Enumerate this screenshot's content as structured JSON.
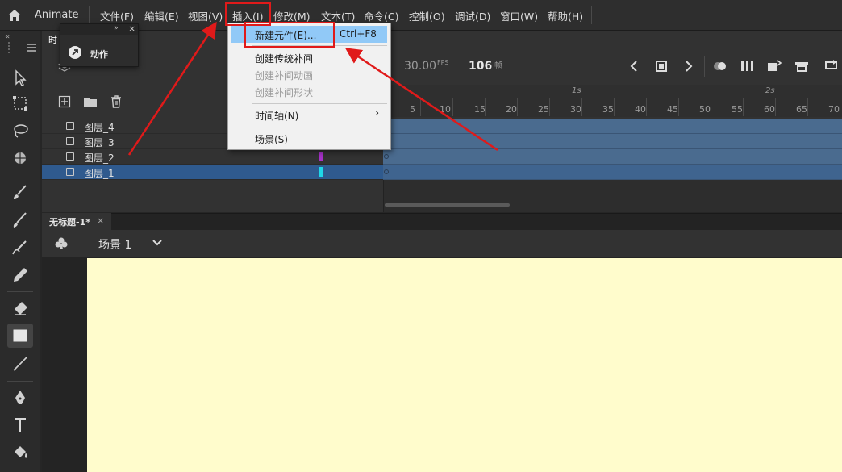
{
  "app": {
    "name": "Animate"
  },
  "menubar": {
    "items": [
      "文件(F)",
      "编辑(E)",
      "视图(V)",
      "插入(I)",
      "修改(M)",
      "文本(T)",
      "命令(C)",
      "控制(O)",
      "调试(D)",
      "窗口(W)",
      "帮助(H)"
    ]
  },
  "insert_menu": {
    "items": [
      {
        "label": "新建元件(E)...",
        "shortcut": "Ctrl+F8",
        "highlighted": true
      },
      {
        "label": "创建传统补间",
        "enabled": true
      },
      {
        "label": "创建补间动画",
        "enabled": false
      },
      {
        "label": "创建补间形状",
        "enabled": false
      },
      {
        "label": "时间轴(N)",
        "submenu": true
      },
      {
        "label": "场景(S)"
      }
    ]
  },
  "timeline": {
    "tab_label": "时间",
    "fps": "30.00",
    "fps_unit": "FPS",
    "frame": "106",
    "frame_unit": "帧",
    "ruler_numbers": [
      "5",
      "10",
      "15",
      "20",
      "25",
      "30",
      "35",
      "40",
      "45",
      "50",
      "55",
      "60",
      "65",
      "70"
    ],
    "ruler_seconds": [
      "1s",
      "2s"
    ],
    "layers": [
      {
        "name": "图层_4",
        "selected": false
      },
      {
        "name": "图层_3",
        "selected": false
      },
      {
        "name": "图层_2",
        "selected": false,
        "color": "#a531c8"
      },
      {
        "name": "图层_1",
        "selected": true,
        "color": "#1fd8e8"
      }
    ]
  },
  "floating_panel": {
    "label": "动作"
  },
  "document": {
    "tab_label": "无标题-1*",
    "close_glyph": "×",
    "scene_label": "场景 1"
  },
  "colors": {
    "stage": "#fffccc",
    "highlight": "#91c9f7",
    "annotation": "#e01a1a",
    "selected_layer": "#2f5a8e"
  }
}
